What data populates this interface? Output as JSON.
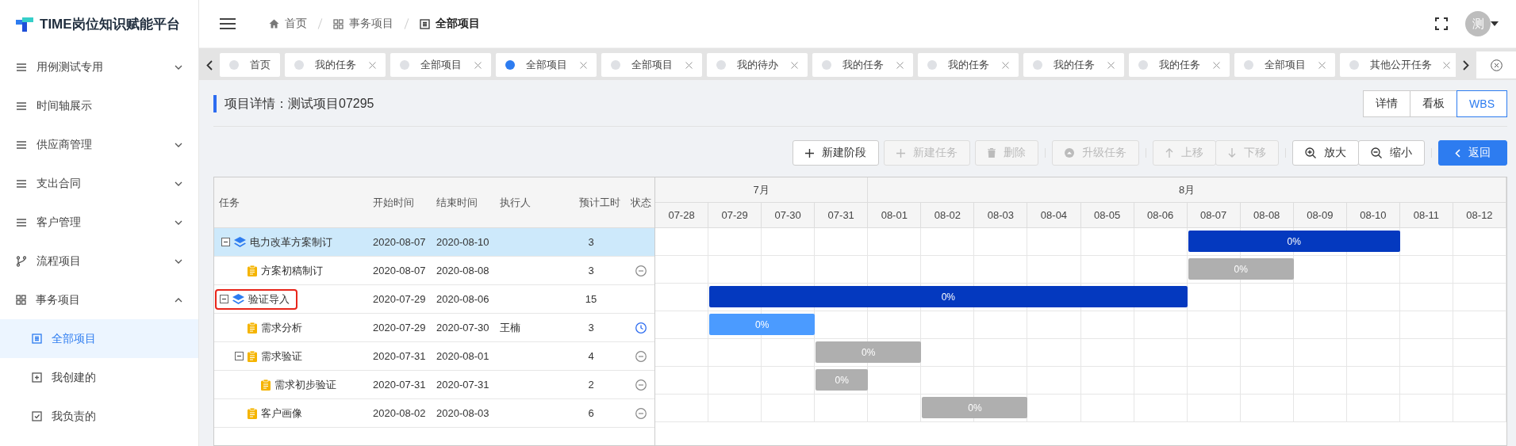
{
  "app": {
    "title": "TIME岗位知识赋能平台"
  },
  "sidebar": {
    "items": [
      {
        "label": "用例测试专用",
        "kind": "list",
        "expanded": false
      },
      {
        "label": "时间轴展示",
        "kind": "list"
      },
      {
        "label": "供应商管理",
        "kind": "list",
        "expanded": false
      },
      {
        "label": "支出合同",
        "kind": "list",
        "expanded": false
      },
      {
        "label": "客户管理",
        "kind": "list",
        "expanded": false
      },
      {
        "label": "流程项目",
        "kind": "branch",
        "expanded": false
      },
      {
        "label": "事务项目",
        "kind": "grid",
        "expanded": true,
        "children": [
          {
            "label": "全部项目",
            "kind": "doc",
            "selected": true
          },
          {
            "label": "我创建的",
            "kind": "plus",
            "selected": false
          },
          {
            "label": "我负责的",
            "kind": "check",
            "selected": false
          }
        ]
      }
    ]
  },
  "header": {
    "breadcrumb": [
      {
        "label": "首页",
        "kind": "home",
        "current": false
      },
      {
        "label": "事务项目",
        "kind": "grid",
        "current": false
      },
      {
        "label": "全部项目",
        "kind": "doc",
        "current": true
      }
    ],
    "avatar": "测"
  },
  "tabs": [
    {
      "label": "首页",
      "selected": false,
      "closable": false
    },
    {
      "label": "我的任务",
      "selected": false,
      "closable": true
    },
    {
      "label": "全部项目",
      "selected": false,
      "closable": true
    },
    {
      "label": "全部项目",
      "selected": true,
      "closable": true
    },
    {
      "label": "全部项目",
      "selected": false,
      "closable": true
    },
    {
      "label": "我的待办",
      "selected": false,
      "closable": true
    },
    {
      "label": "我的任务",
      "selected": false,
      "closable": true
    },
    {
      "label": "我的任务",
      "selected": false,
      "closable": true
    },
    {
      "label": "我的任务",
      "selected": false,
      "closable": true
    },
    {
      "label": "我的任务",
      "selected": false,
      "closable": true
    },
    {
      "label": "全部项目",
      "selected": false,
      "closable": true
    },
    {
      "label": "其他公开任务",
      "selected": false,
      "closable": true
    }
  ],
  "page": {
    "title": "项目详情：测试项目07295",
    "views": [
      {
        "label": "详情",
        "selected": false
      },
      {
        "label": "看板",
        "selected": false
      },
      {
        "label": "WBS",
        "selected": true
      }
    ]
  },
  "toolbar": [
    {
      "joined": false,
      "buttons": [
        {
          "label": "新建阶段",
          "kind": "plus",
          "disabled": false
        },
        {
          "label": "新建任务",
          "kind": "plus",
          "disabled": true
        },
        {
          "label": "删除",
          "kind": "trash",
          "disabled": true
        }
      ]
    },
    {
      "joined": false,
      "buttons": [
        {
          "label": "升级任务",
          "kind": "up-circle",
          "disabled": true
        }
      ]
    },
    {
      "joined": true,
      "buttons": [
        {
          "label": "上移",
          "kind": "arrow-up",
          "disabled": true
        },
        {
          "label": "下移",
          "kind": "arrow-down",
          "disabled": true
        }
      ]
    },
    {
      "joined": true,
      "buttons": [
        {
          "label": "放大",
          "kind": "zoom-in",
          "disabled": false
        },
        {
          "label": "缩小",
          "kind": "zoom-out",
          "disabled": false
        }
      ]
    },
    {
      "joined": false,
      "buttons": [
        {
          "label": "返回",
          "kind": "back",
          "disabled": false,
          "primary": true
        }
      ]
    }
  ],
  "wbs": {
    "columns": [
      "任务",
      "开始时间",
      "结束时间",
      "执行人",
      "预计工时",
      "状态"
    ],
    "months": [
      {
        "label": "7月",
        "days": [
          "07-28",
          "07-29",
          "07-30",
          "07-31"
        ]
      },
      {
        "label": "8月",
        "days": [
          "08-01",
          "08-02",
          "08-03",
          "08-04",
          "08-05",
          "08-06",
          "08-07",
          "08-08",
          "08-09",
          "08-10",
          "08-11",
          "08-12"
        ]
      }
    ],
    "rows": [
      {
        "name": "电力改革方案制订",
        "kind": "phase",
        "start": "2020-08-07",
        "end": "2020-08-10",
        "hours": "3",
        "progress": "0%",
        "selected": true,
        "marked": false,
        "expanded": true,
        "children": [
          {
            "name": "方案初稿制订",
            "kind": "task",
            "start": "2020-08-07",
            "end": "2020-08-08",
            "hours": "3",
            "progress": "0%",
            "started": false,
            "selected": false,
            "marked": false
          }
        ]
      },
      {
        "name": "验证导入",
        "kind": "phase",
        "start": "2020-07-29",
        "end": "2020-08-06",
        "hours": "15",
        "progress": "0%",
        "selected": false,
        "marked": true,
        "expanded": true,
        "children": [
          {
            "name": "需求分析",
            "kind": "task",
            "start": "2020-07-29",
            "end": "2020-07-30",
            "assignee": "王楠",
            "hours": "3",
            "progress": "0%",
            "started": true,
            "selected": false,
            "marked": false
          },
          {
            "name": "需求验证",
            "kind": "task",
            "start": "2020-07-31",
            "end": "2020-08-01",
            "hours": "4",
            "progress": "0%",
            "started": false,
            "selected": false,
            "marked": false,
            "expanded": true,
            "children": [
              {
                "name": "需求初步验证",
                "kind": "task",
                "start": "2020-07-31",
                "end": "2020-07-31",
                "hours": "2",
                "progress": "0%",
                "started": false,
                "selected": false,
                "marked": false
              }
            ]
          },
          {
            "name": "客户画像",
            "kind": "task",
            "start": "2020-08-02",
            "end": "2020-08-03",
            "hours": "6",
            "progress": "0%",
            "started": false,
            "selected": false,
            "marked": false
          }
        ]
      }
    ]
  }
}
